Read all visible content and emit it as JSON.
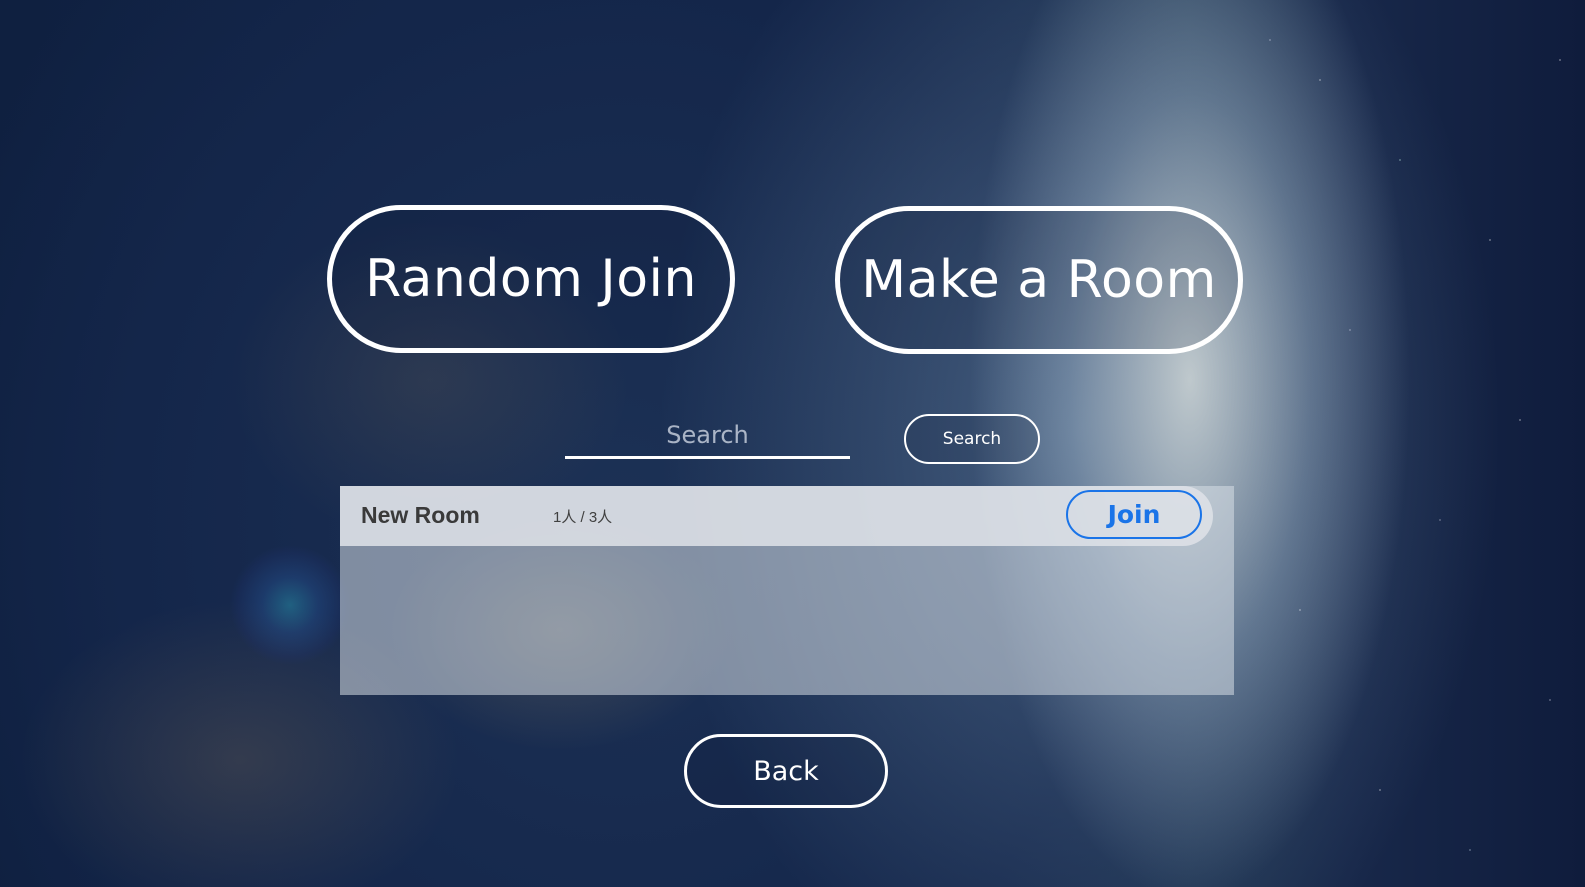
{
  "actions": {
    "random_join_label": "Random Join",
    "make_room_label": "Make a Room"
  },
  "search": {
    "placeholder": "Search",
    "value": "",
    "button_label": "Search"
  },
  "rooms": [
    {
      "name": "New Room",
      "occupancy": "1人 / 3人",
      "join_label": "Join"
    }
  ],
  "back_label": "Back",
  "colors": {
    "accent": "#1a74e8",
    "button_border": "#ffffff",
    "list_background": "#d7dee6"
  },
  "background": "earth-from-space-night-image"
}
